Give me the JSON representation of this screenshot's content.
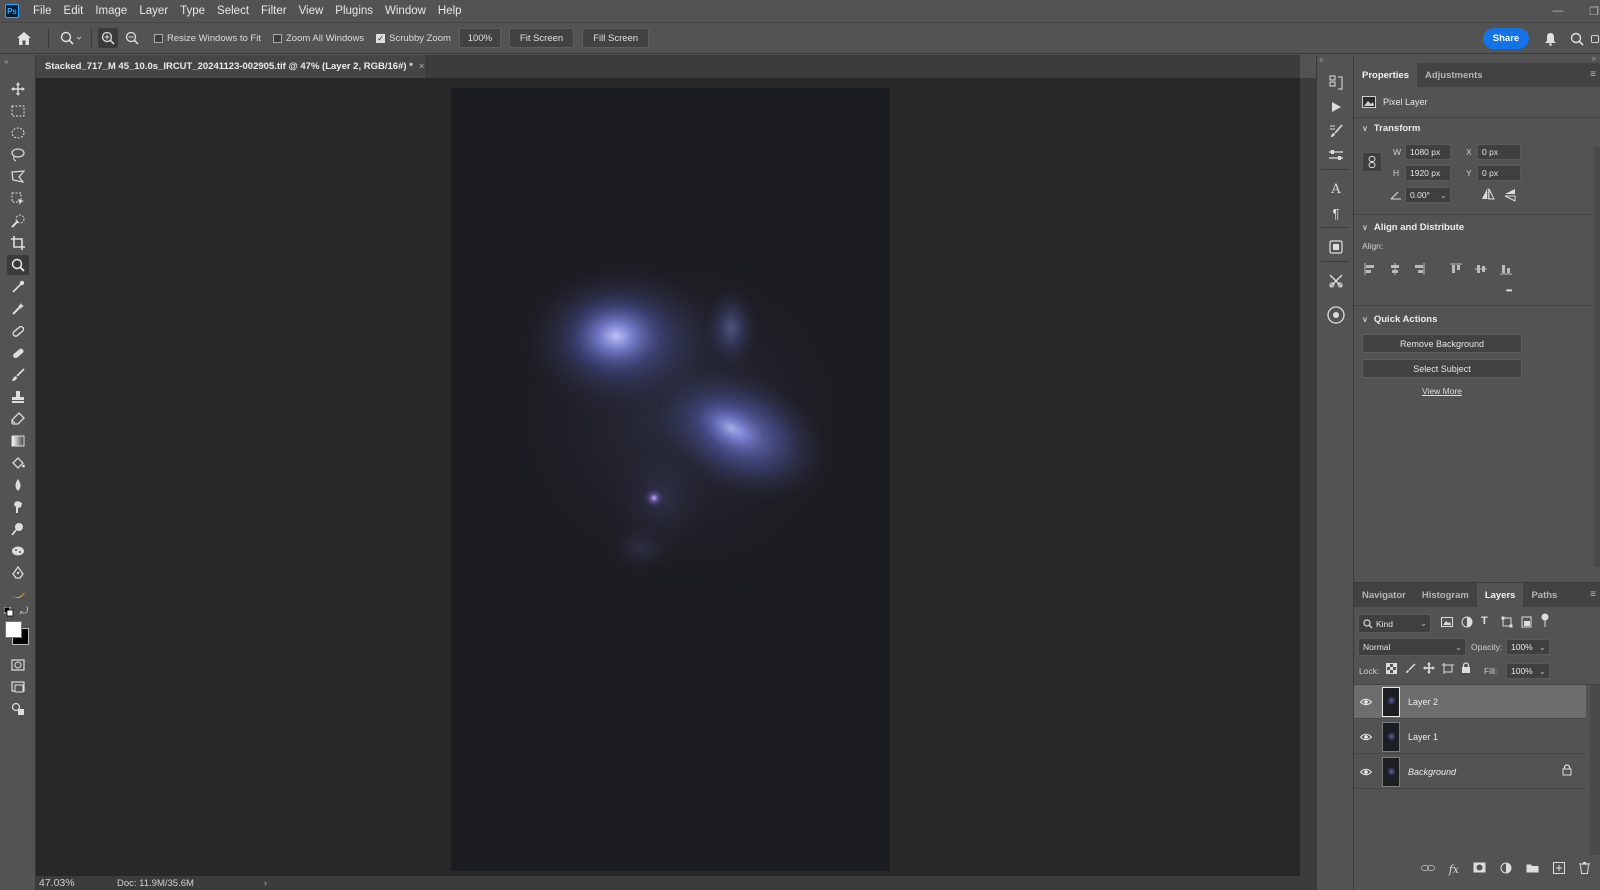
{
  "menubar": {
    "logo": "Ps",
    "items": [
      "File",
      "Edit",
      "Image",
      "Layer",
      "Type",
      "Select",
      "Filter",
      "View",
      "Plugins",
      "Window",
      "Help"
    ]
  },
  "options": {
    "resize_windows": "Resize Windows to Fit",
    "zoom_all": "Zoom All Windows",
    "scrubby_zoom": "Scrubby Zoom",
    "zoom_value": "100%",
    "fit_screen": "Fit Screen",
    "fill_screen": "Fill Screen",
    "share": "Share"
  },
  "document": {
    "tab_title": "Stacked_717_M 45_10.0s_IRCUT_20241123-002905.tif @ 47% (Layer 2, RGB/16#) *",
    "close": "×",
    "zoom": "47.03%",
    "doc_size": "Doc: 11.9M/35.6M"
  },
  "properties": {
    "tabs": [
      "Properties",
      "Adjustments"
    ],
    "layer_type": "Pixel Layer",
    "transform": {
      "title": "Transform",
      "w_label": "W",
      "w": "1080 px",
      "h_label": "H",
      "h": "1920 px",
      "x_label": "X",
      "x": "0 px",
      "y_label": "Y",
      "y": "0 px",
      "angle": "0.00°"
    },
    "align": {
      "title": "Align and Distribute",
      "label": "Align:",
      "more": "•••"
    },
    "quick_actions": {
      "title": "Quick Actions",
      "remove_bg": "Remove Background",
      "select_subject": "Select Subject",
      "view_more": "View More"
    }
  },
  "layers_panel": {
    "tabs": [
      "Navigator",
      "Histogram",
      "Layers",
      "Paths"
    ],
    "filter_kind": "Kind",
    "blend_mode": "Normal",
    "opacity_label": "Opacity:",
    "opacity": "100%",
    "lock_label": "Lock:",
    "fill_label": "Fill:",
    "fill": "100%",
    "layers": [
      {
        "name": "Layer 2",
        "selected": true
      },
      {
        "name": "Layer 1",
        "selected": false
      },
      {
        "name": "Background",
        "selected": false
      }
    ]
  },
  "colors": {
    "accent": "#1473e6",
    "nebula": "#6a70c8"
  }
}
